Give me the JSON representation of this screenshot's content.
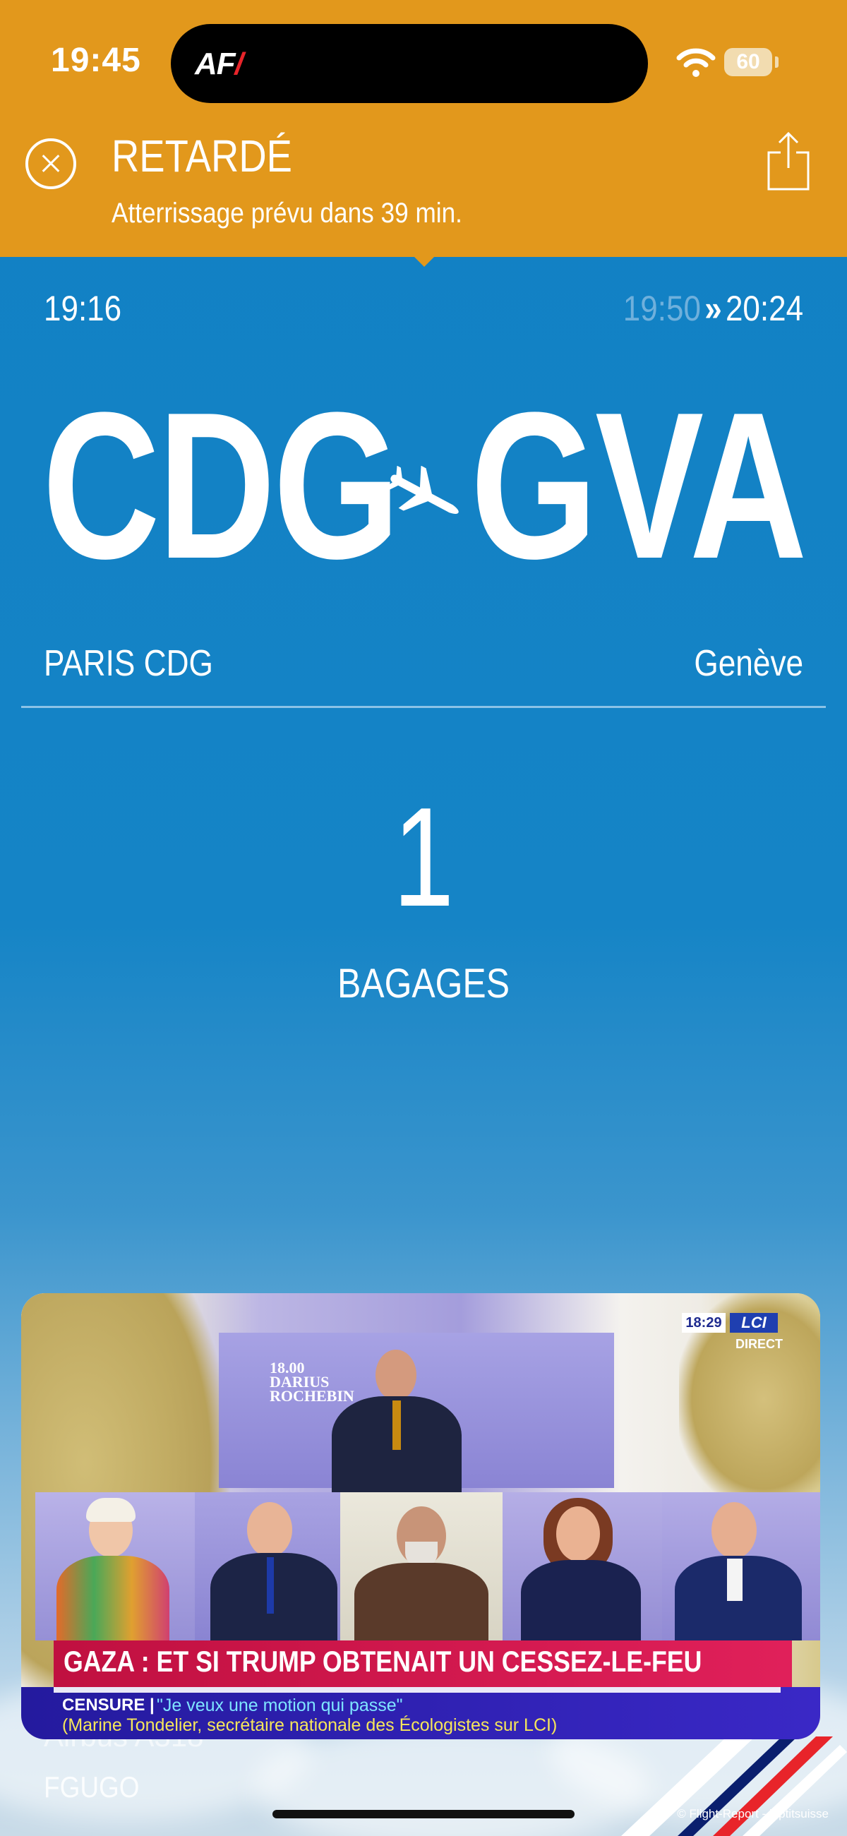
{
  "status_bar": {
    "time": "19:45",
    "battery": "60",
    "island_logo": "AF"
  },
  "header": {
    "status": "RETARDÉ",
    "subtitle": "Atterrissage prévu dans 39 min.",
    "close_icon": "close-icon",
    "share_icon": "share-icon",
    "color": "#e2981c"
  },
  "flight": {
    "departure_time": "19:16",
    "arrival_time_old": "19:50",
    "arrival_separator": "»",
    "arrival_time_new": "20:24",
    "origin_code": "CDG",
    "destination_code": "GVA",
    "origin_city": "PARIS CDG",
    "destination_city": "Genève"
  },
  "baggage": {
    "count": "1",
    "label": "BAGAGES"
  },
  "aircraft": {
    "type": "Airbus A318",
    "registration": "FGUGO"
  },
  "pip": {
    "clock": "18:29",
    "channel": "LCI",
    "live": "DIRECT",
    "studio_text_1": "18.00",
    "studio_text_2": "DARIUS",
    "studio_text_3": "ROCHEBIN",
    "headline": "GAZA : ET SI TRUMP OBTENAIT UN CESSEZ-LE-FEU",
    "tag": "CENSURE |",
    "quote": "\"Je veux une motion qui passe\"",
    "attribution": "(Marine Tondelier, secrétaire nationale des Écologistes sur LCI)"
  },
  "credit": "© Flight-Report - leptitsuisse",
  "colors": {
    "background": "#1581c4",
    "header": "#e2981c",
    "old_time": "#6fb0dc"
  }
}
